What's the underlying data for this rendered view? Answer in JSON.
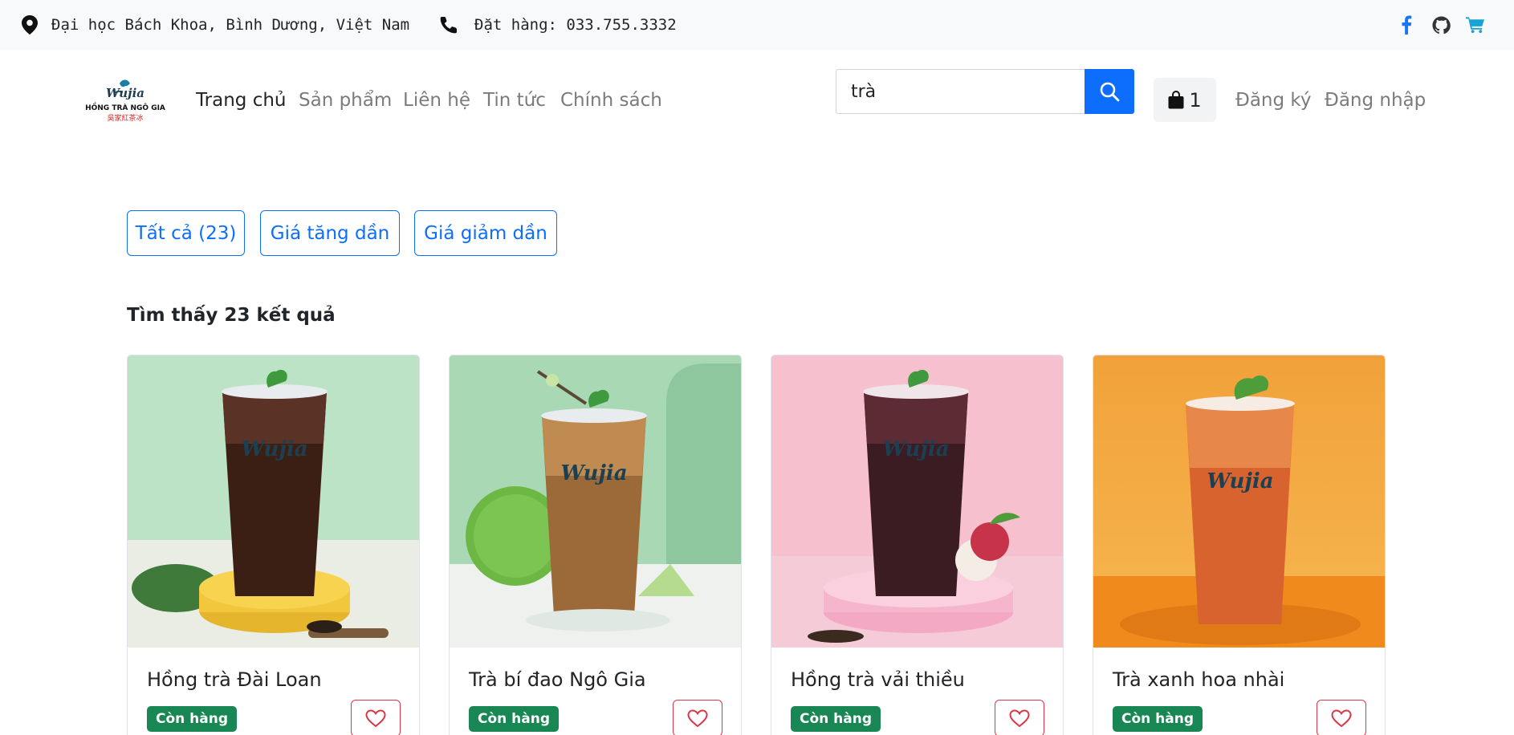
{
  "topbar": {
    "address": "Đại học Bách Khoa, Bình Dương, Việt Nam",
    "phone": "Đặt hàng: 033.755.3332",
    "icons": [
      "map-marker-icon",
      "phone-icon",
      "facebook-icon",
      "github-icon",
      "shopping-cart-icon"
    ]
  },
  "logo": {
    "line1": "Wujia",
    "line2": "HỒNG TRÀ NGÔ GIA",
    "line3": "吳家紅茶冰"
  },
  "nav": {
    "items": [
      {
        "label": "Trang chủ"
      },
      {
        "label": "Sản phẩm"
      },
      {
        "label": "Liên hệ"
      },
      {
        "label": "Tin tức"
      },
      {
        "label": "Chính sách"
      }
    ],
    "active_index": 0
  },
  "search": {
    "value": "trà"
  },
  "cart": {
    "count": "1"
  },
  "auth": {
    "register": "Đăng ký",
    "login": "Đăng nhập"
  },
  "filters": [
    {
      "label": "Tất cả (23)"
    },
    {
      "label": "Giá tăng dần"
    },
    {
      "label": "Giá giảm dần"
    }
  ],
  "results": {
    "text": "Tìm thấy 23 kết quả"
  },
  "products": [
    {
      "name": "Hồng trà Đài Loan",
      "status": "Còn hàng"
    },
    {
      "name": "Trà bí đao Ngô Gia",
      "status": "Còn hàng"
    },
    {
      "name": "Hồng trà vải thiều",
      "status": "Còn hàng"
    },
    {
      "name": "Trà xanh hoa nhài",
      "status": "Còn hàng"
    }
  ],
  "colors": {
    "primary": "#0d6efd",
    "success": "#198754",
    "danger": "#dc3545",
    "topbar_bg": "#f8f9fa"
  }
}
